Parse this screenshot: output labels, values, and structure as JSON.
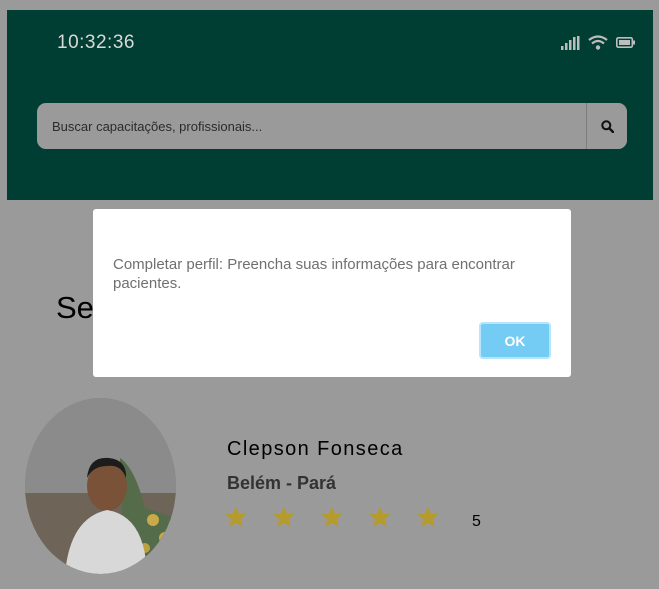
{
  "status_bar": {
    "time": "10:32:36",
    "icons": [
      "signal-icon",
      "wifi-icon",
      "battery-icon"
    ]
  },
  "search": {
    "placeholder": "Buscar capacitações, profissionais...",
    "button_icon": "search-icon"
  },
  "section": {
    "title_visible": "Se"
  },
  "profile": {
    "name": "Clepson Fonseca",
    "location": "Belém - Pará",
    "rating": 5,
    "rating_text": "5"
  },
  "dialog": {
    "message": "Completar perfil: Preencha suas informações para encontrar pacientes.",
    "ok_label": "OK"
  },
  "colors": {
    "header": "#003d32",
    "overlay": "#9a9a9a",
    "star": "#b59a2e",
    "ok_button": "#74cbf3"
  }
}
